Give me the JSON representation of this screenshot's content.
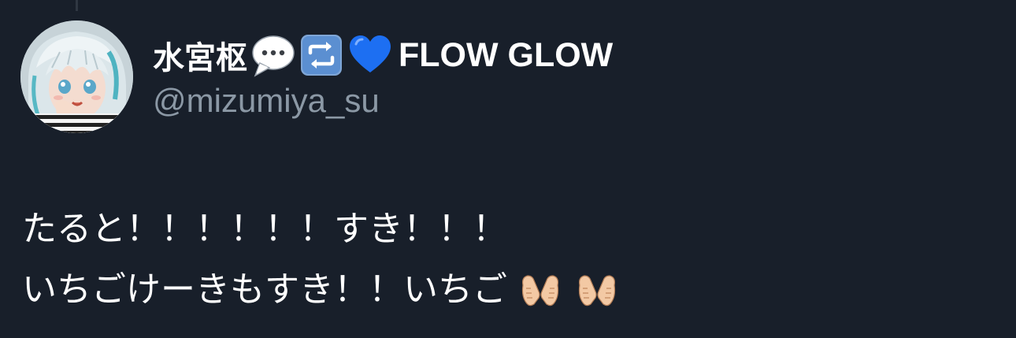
{
  "post": {
    "author": {
      "display_name": "水宮枢",
      "badges": [
        "speech-bubble-icon",
        "repeat-icon",
        "blue-heart-icon"
      ],
      "display_name_suffix": "FLOW GLOW",
      "handle": "@mizumiya_su"
    },
    "text_lines": [
      "たると！！！！！！すき！！！",
      "いちごけーきもすき！！いちご"
    ],
    "trailing_emoji": [
      "heart-hands-icon",
      "heart-hands-icon"
    ]
  },
  "colors": {
    "background": "#181f2a",
    "primary_text": "#ffffff",
    "secondary_text": "#8b98a5",
    "blue_heart": "#1d6ff2"
  }
}
